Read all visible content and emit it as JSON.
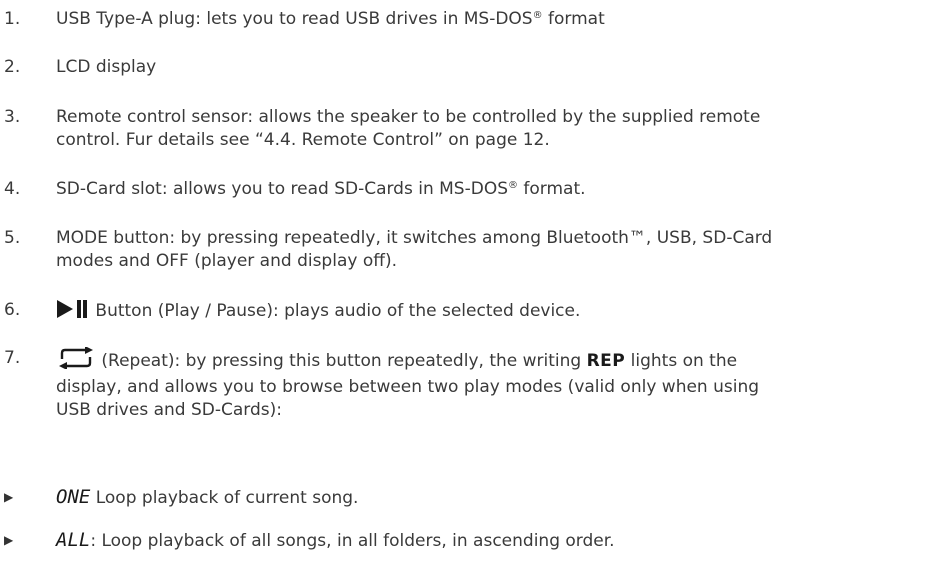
{
  "items": [
    {
      "num": "1.",
      "pre": "USB Type-A plug: lets you to read USB drives in MS-DOS",
      "reg": "®",
      "post": " format"
    },
    {
      "num": "2.",
      "text": "LCD display"
    },
    {
      "num": "3.",
      "line1": "Remote control sensor: allows the speaker to be controlled by the supplied remote",
      "line2": "control. Fur details see “4.4. Remote Control” on page 12."
    },
    {
      "num": "4.",
      "pre": "SD-Card slot: allows you to read SD-Cards in MS-DOS",
      "reg": "®",
      "post": " format."
    },
    {
      "num": "5.",
      "line1": "MODE button: by pressing repeatedly, it switches among Bluetooth™, USB, SD-Card",
      "line2": "modes and OFF (player and display off)."
    },
    {
      "num": "6.",
      "text": "Button (Play / Pause): plays audio of the selected device."
    },
    {
      "num": "7.",
      "line1_pre": " (Repeat): by pressing this button repeatedly, the writing ",
      "rep": "REP",
      "line1_post": " lights on the",
      "line2": "display, and allows you to browse between two play modes (valid only when using",
      "line3": "USB drives and SD-Cards):"
    }
  ],
  "bullets": [
    {
      "mark": "▶",
      "label": "ONE",
      "text": " Loop playback of current song."
    },
    {
      "mark": "▶",
      "label": "ALL",
      "text": ": Loop playback of all songs, in all folders, in ascending order."
    }
  ]
}
